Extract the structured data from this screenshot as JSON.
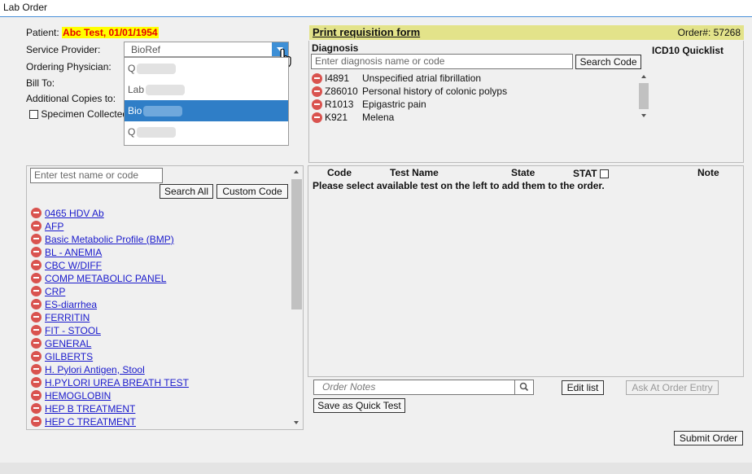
{
  "window": {
    "title": "Lab Order"
  },
  "patient": {
    "label": "Patient:",
    "value": "Abc Test, 01/01/1954"
  },
  "service_provider": {
    "label": "Service Provider:",
    "selected": "BioRef",
    "options": [
      {
        "text": "Q"
      },
      {
        "text": "Lab"
      },
      {
        "text": "Bio",
        "selected": true
      },
      {
        "text": "Q"
      }
    ]
  },
  "fields": {
    "ordering_physician": "Ordering Physician:",
    "bill_to": "Bill To:",
    "additional_copies": "Additional Copies to:",
    "specimen_collected": "Specimen Collected"
  },
  "requisition": {
    "link": "Print requisition form",
    "order_number": "Order#: 57268"
  },
  "diagnosis": {
    "label": "Diagnosis",
    "quicklist": "ICD10 Quicklist",
    "placeholder": "Enter diagnosis name or code",
    "search_button": "Search Code",
    "items": [
      {
        "code": "I4891",
        "name": "Unspecified atrial fibrillation"
      },
      {
        "code": "Z86010",
        "name": "Personal history of colonic polyps"
      },
      {
        "code": "R1013",
        "name": "Epigastric pain"
      },
      {
        "code": "K921",
        "name": "Melena"
      }
    ]
  },
  "tests": {
    "placeholder": "Enter test name or code",
    "search_all": "Search All",
    "custom_code": "Custom Code",
    "items": [
      "0465 HDV Ab",
      "AFP",
      "Basic Metabolic Profile (BMP)",
      "BL - ANEMIA",
      "CBC W/DIFF",
      "COMP METABOLIC PANEL",
      "CRP",
      "ES-diarrhea",
      "FERRITIN",
      "FIT - STOOL",
      "GENERAL",
      "GILBERTS",
      "H. Pylori Antigen, Stool",
      "H.PYLORI UREA BREATH TEST",
      "HEMOGLOBIN",
      "HEP B TREATMENT",
      "HEP C TREATMENT"
    ]
  },
  "order_table": {
    "columns": {
      "code": "Code",
      "test_name": "Test Name",
      "state": "State",
      "stat": "STAT",
      "note": "Note"
    },
    "empty_message": "Please select available test on the left to add them to the order."
  },
  "notes": {
    "placeholder": "Order Notes",
    "edit_list": "Edit list",
    "ask_at_entry": "Ask At Order Entry",
    "save_quick_test": "Save as Quick Test"
  },
  "submit": "Submit Order",
  "colors": {
    "accent": "#3d8fd6",
    "patient_highlight": "#ffff00",
    "patient_text": "#e60000",
    "link": "#1a1acc",
    "header_band": "#e3e38a"
  }
}
